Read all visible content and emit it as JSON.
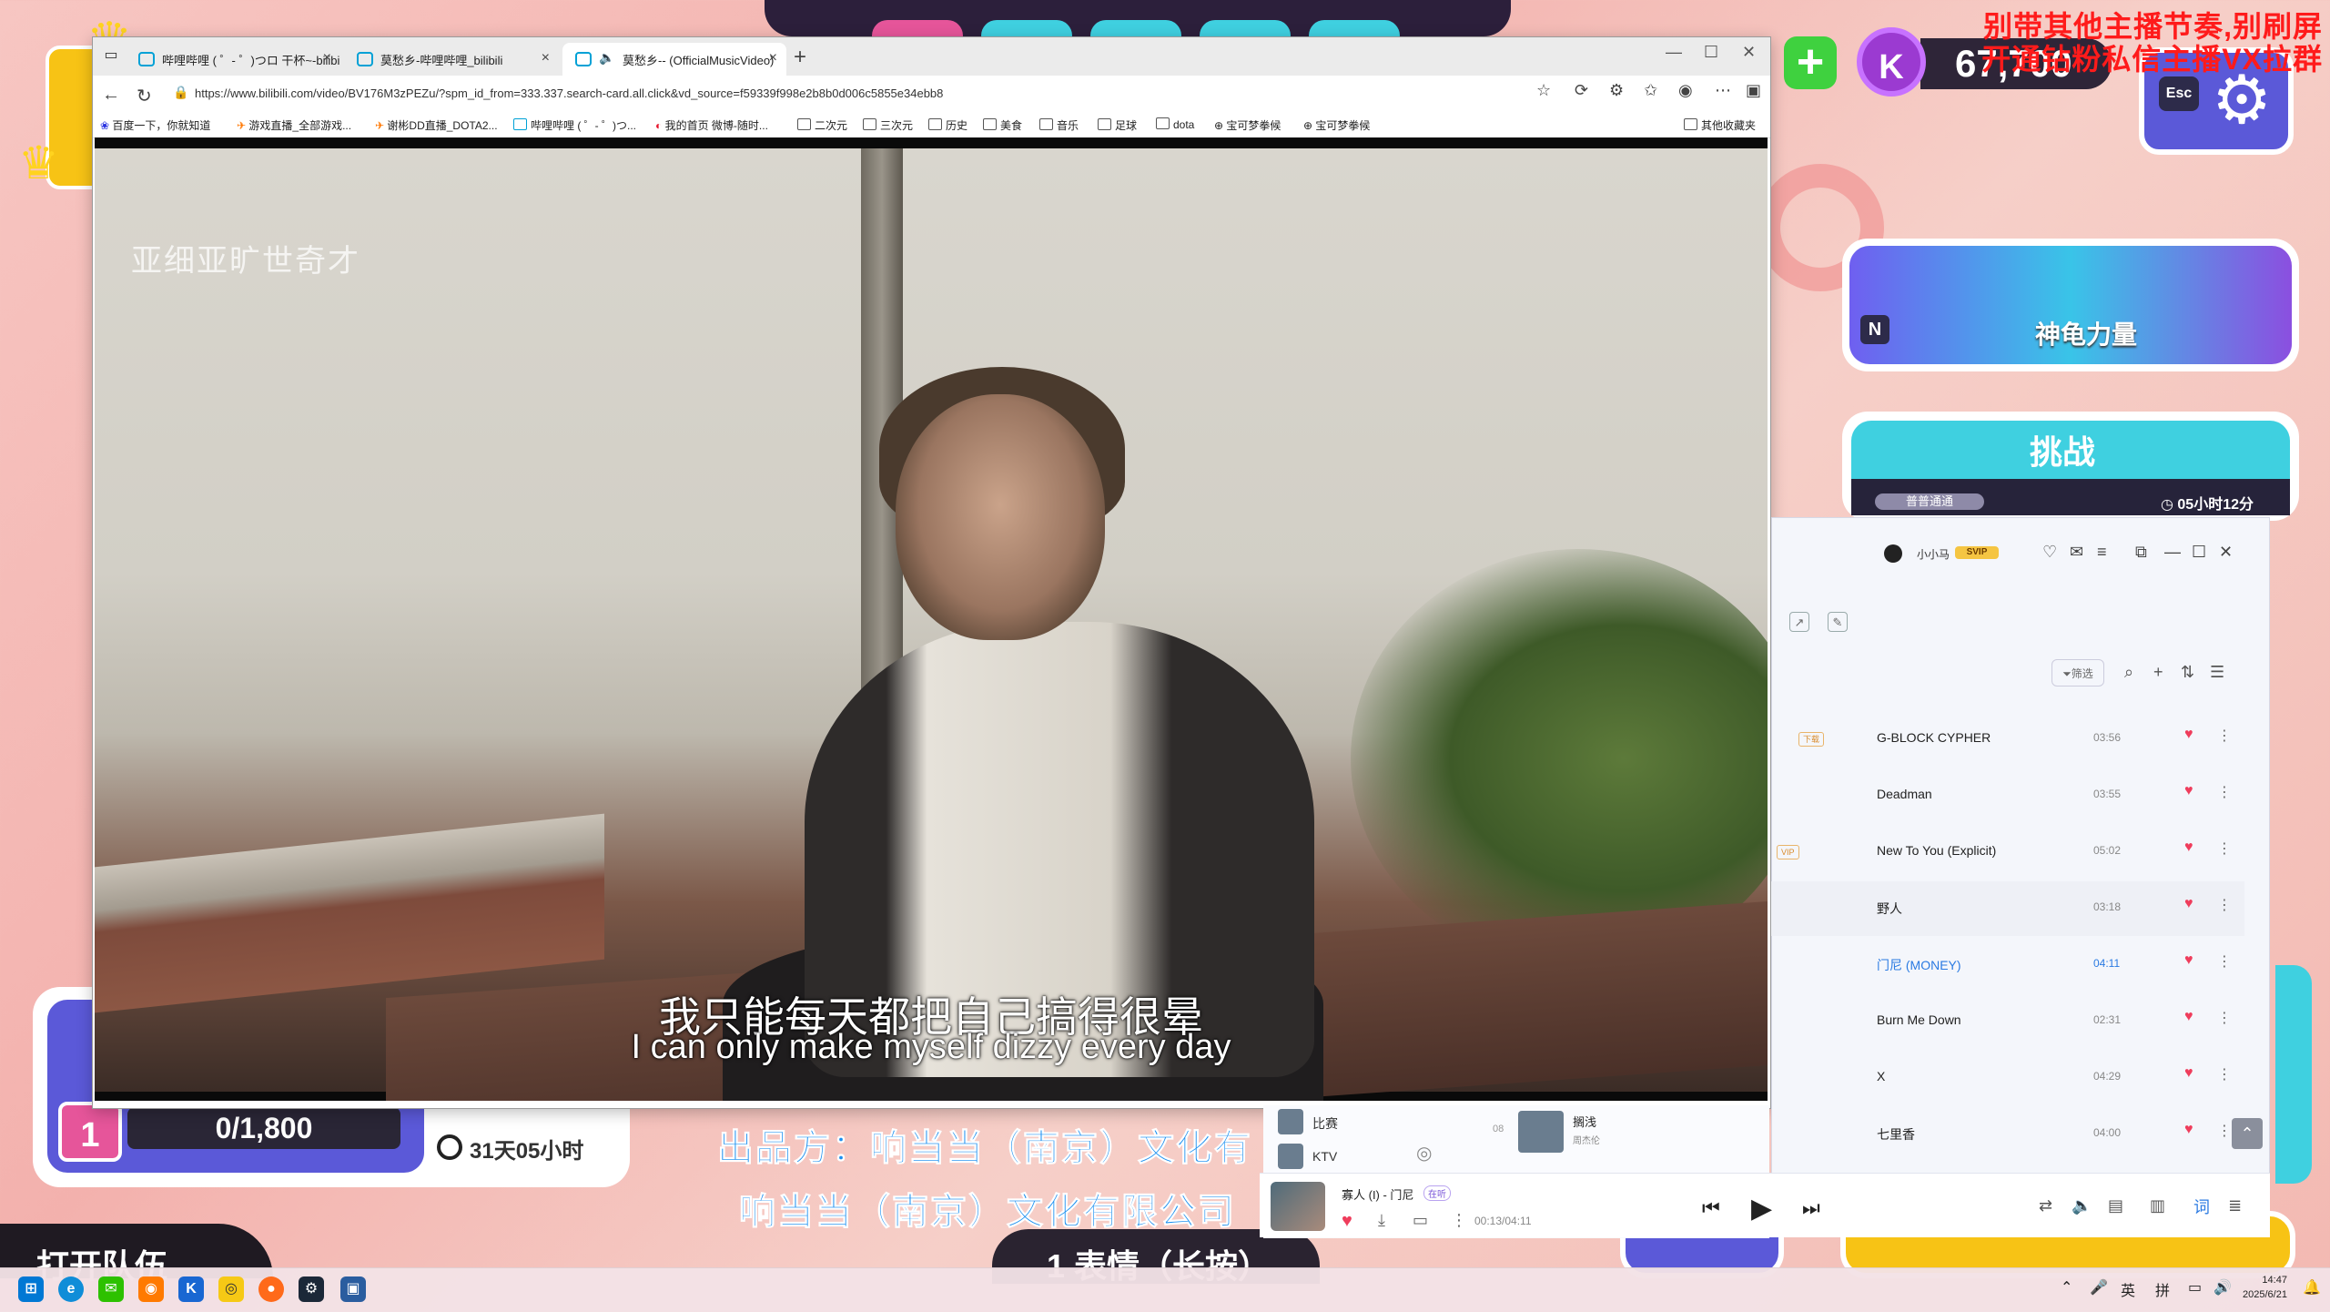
{
  "stream_overlay": {
    "notice_line1": "别带其他主播节奏,别刷屏",
    "notice_line2": "开通钻粉私信主播VX拉群",
    "coin_value": "67,700",
    "esc_key": "Esc",
    "card_key": "N",
    "card_title": "神龟力量",
    "challenge_title": "挑战",
    "challenge_tag": "普普通通",
    "challenge_timer": "05小时12分",
    "task_level": "1",
    "task_progress": "0/1,800",
    "task_time": "31天05小时",
    "producer_line1": "出品方：响当当（南京）文化有",
    "producer_line2": "响当当（南京）文化有限公司",
    "bottom_left_text": "打开队伍",
    "bottom_mid_text": "1 表情（长按）"
  },
  "browser": {
    "tabs": [
      {
        "title": "哔哩哔哩 ( ゜- ゜)つロ 干杯~-bilibili"
      },
      {
        "title": "莫愁乡-哔哩哔哩_bilibili"
      },
      {
        "title": "莫愁乡-- (OfficialMusicVideo)"
      }
    ],
    "url": "https://www.bilibili.com/video/BV176M3zPEZu/?spm_id_from=333.337.search-card.all.click&vd_source=f59339f998e2b8b0d006c5855e34ebb8",
    "bookmarks": [
      "百度一下，你就知道",
      "游戏直播_全部游戏...",
      "谢彬DD直播_DOTA2...",
      "哔哩哔哩 ( ゜- ゜)つ...",
      "我的首页 微博-随时...",
      "二次元",
      "三次元",
      "历史",
      "美食",
      "音乐",
      "足球",
      "dota",
      "宝可梦拳候",
      "宝可梦拳候"
    ],
    "other_bookmarks": "其他收藏夹"
  },
  "video": {
    "watermark": "亚细亚旷世奇才",
    "subtitle_cn": "我只能每天都把自己搞得很晕",
    "subtitle_en": "I can only make myself dizzy every day"
  },
  "music": {
    "user_name": "小小马",
    "svip_badge": "SVIP",
    "filter_label": "筛选",
    "songs": [
      {
        "title": "G-BLOCK CYPHER",
        "duration": "03:56"
      },
      {
        "title": "Deadman",
        "duration": "03:55"
      },
      {
        "title": "New To You (Explicit)",
        "duration": "05:02"
      },
      {
        "title": "野人",
        "duration": "03:18"
      },
      {
        "title": "门尼 (MONEY)",
        "duration": "04:11"
      },
      {
        "title": "Burn Me Down",
        "duration": "02:31"
      },
      {
        "title": "X",
        "duration": "04:29"
      },
      {
        "title": "七里香",
        "duration": "04:00"
      }
    ],
    "side_items": [
      "比赛",
      "KTV"
    ],
    "side_song_num": "08",
    "side_song_title": "搁浅",
    "side_song_artist": "周杰伦",
    "now_playing": "寡人 (I) - 门尼",
    "now_playing_badge": "在听",
    "now_time": "00:13/04:11",
    "lyric_button": "词"
  },
  "taskbar": {
    "ime_1": "英",
    "ime_2": "拼",
    "time": "14:47",
    "date": "2025/6/21"
  }
}
